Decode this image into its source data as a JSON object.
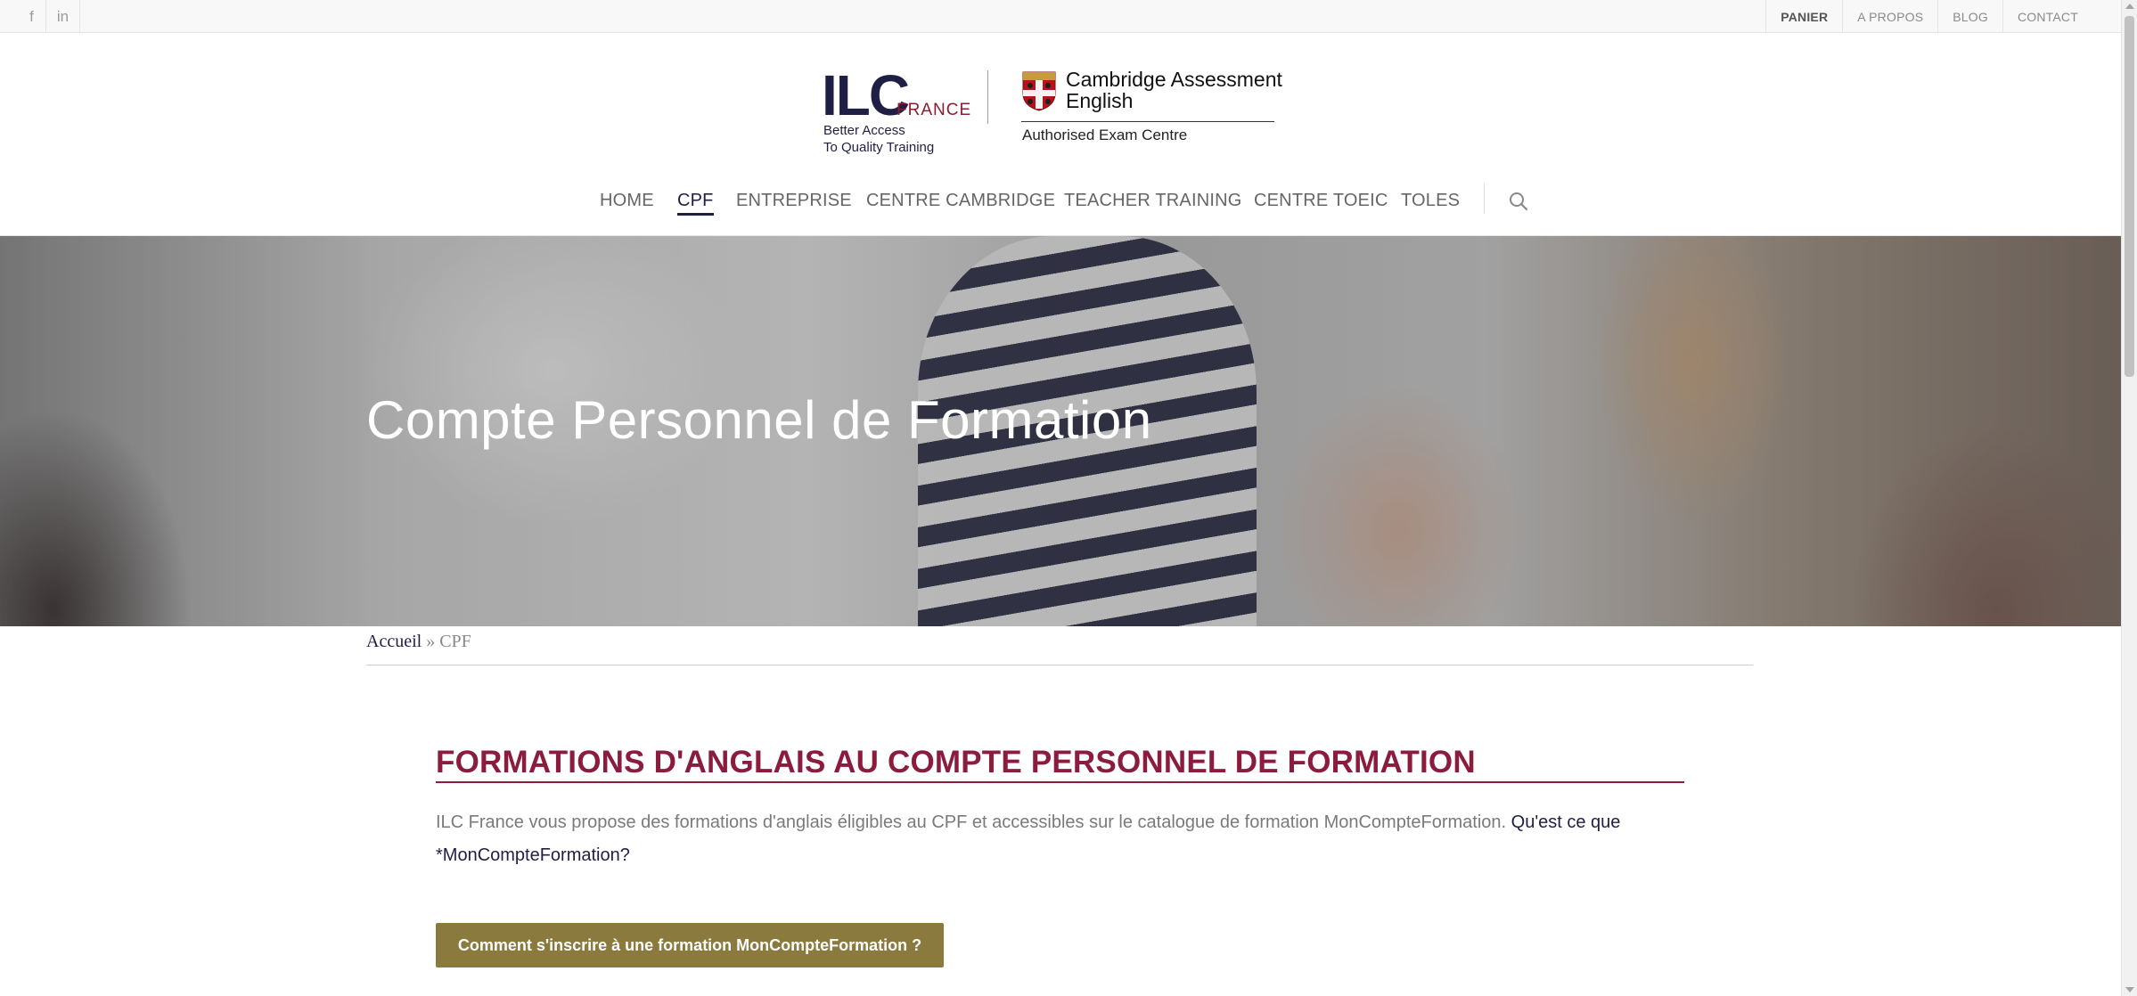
{
  "topbar": {
    "social": [
      {
        "label": "f",
        "icon": "facebook-icon"
      },
      {
        "label": "in",
        "icon": "linkedin-icon"
      }
    ],
    "links": [
      "PANIER",
      "A PROPOS",
      "BLOG",
      "CONTACT"
    ]
  },
  "logo": {
    "ilc": "ILC",
    "france": "FRANCE",
    "tagline_1": "Better Access",
    "tagline_2": "To Quality Training",
    "cambridge_1": "Cambridge Assessment",
    "cambridge_2": "English",
    "authorised": "Authorised Exam Centre"
  },
  "nav": {
    "items": [
      "HOME",
      "CPF",
      "ENTREPRISE",
      "CENTRE CAMBRIDGE",
      "TEACHER TRAINING",
      "CENTRE TOEIC",
      "TOLES"
    ],
    "active": "CPF"
  },
  "hero": {
    "title": "Compte Personnel de Formation"
  },
  "breadcrumb": {
    "home": "Accueil",
    "separator": " » ",
    "current": "CPF"
  },
  "content": {
    "title": "FORMATIONS D'ANGLAIS AU COMPTE PERSONNEL DE FORMATION",
    "intro": "ILC France vous propose des formations d'anglais éligibles au CPF et accessibles sur le catalogue de formation MonCompteFormation. ",
    "intro_link": "Qu'est ce que *MonCompteFormation?",
    "cta": "Comment s'inscrire à une formation MonCompteFormation ?"
  },
  "colors": {
    "navy": "#1f1f45",
    "burgundy": "#8c1c3e",
    "gold": "#8a7a3d"
  }
}
